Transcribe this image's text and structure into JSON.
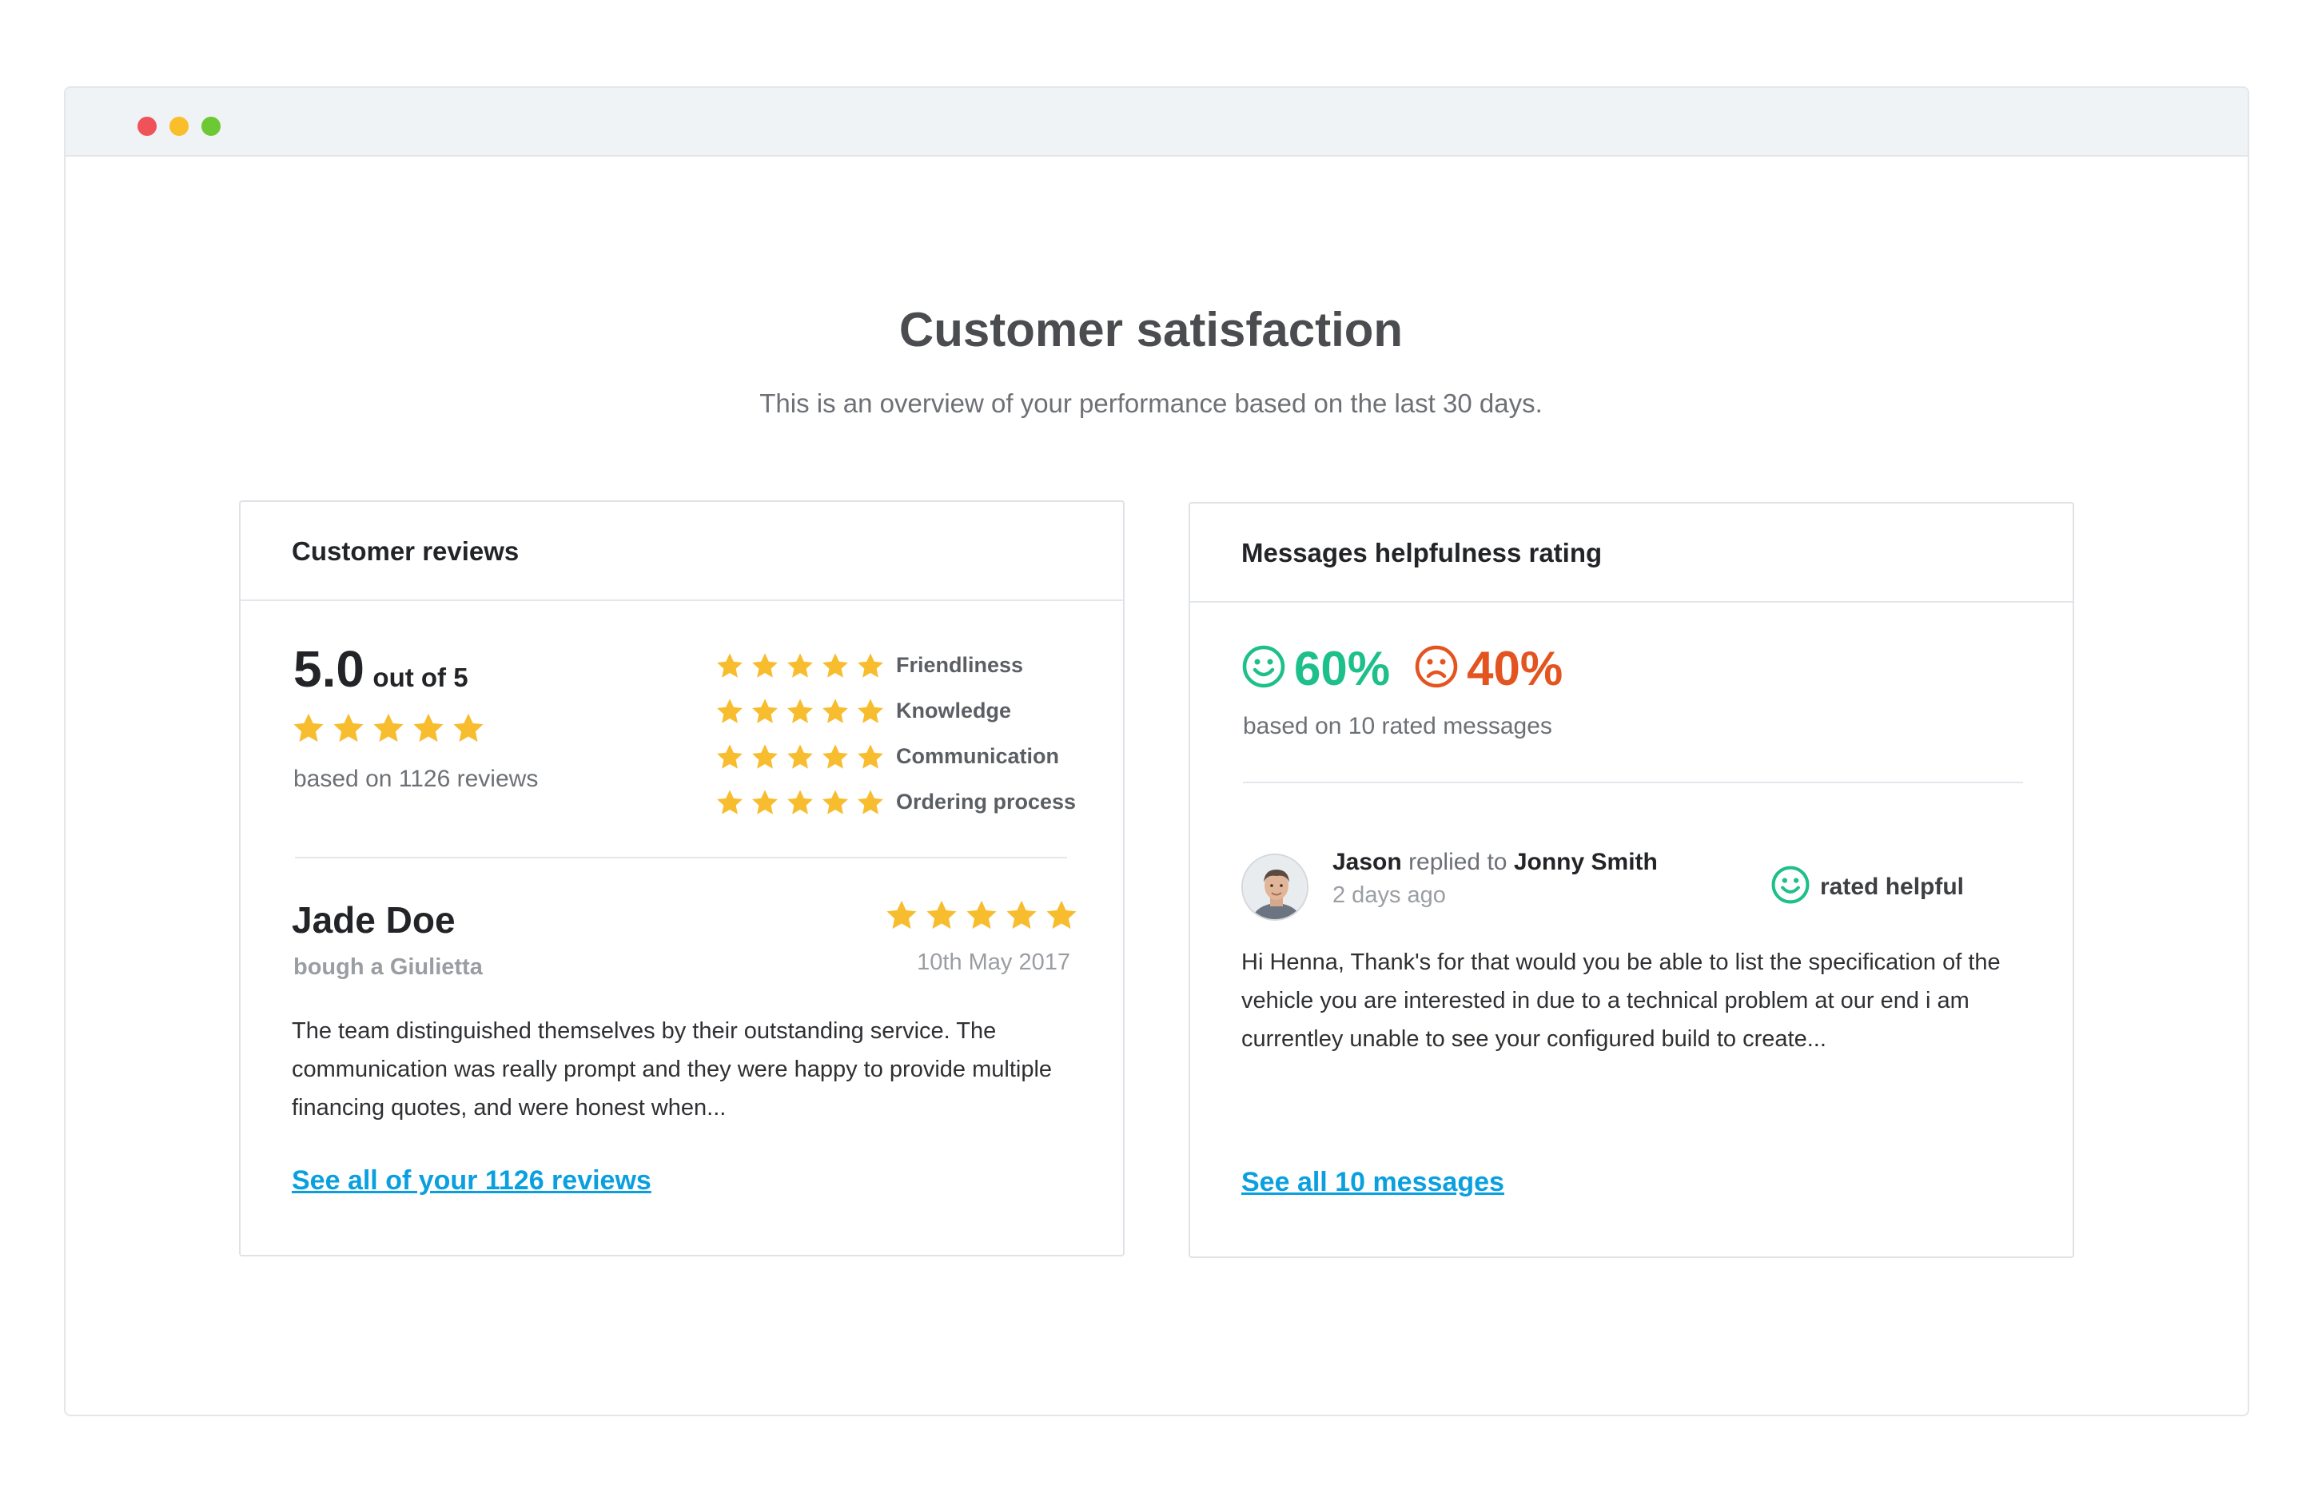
{
  "page": {
    "title": "Customer satisfaction",
    "subtitle": "This is an overview of your performance based on the last 30 days."
  },
  "reviews_card": {
    "header": "Customer reviews",
    "score": "5.0",
    "score_suffix": "out of 5",
    "overall_stars": 5,
    "based_on": "based on 1126 reviews",
    "categories": [
      {
        "label": "Friendliness",
        "stars": 5
      },
      {
        "label": "Knowledge",
        "stars": 5
      },
      {
        "label": "Communication",
        "stars": 5
      },
      {
        "label": "Ordering process",
        "stars": 5
      }
    ],
    "review": {
      "name": "Jade Doe",
      "bought": "bough a Giulietta",
      "stars": 5,
      "date": "10th May 2017",
      "text": "The team distinguished themselves by their outstanding service. The communication was really prompt and they were happy to provide multiple financing quotes, and were honest when..."
    },
    "link": "See all of your 1126 reviews"
  },
  "messages_card": {
    "header": "Messages helpfulness rating",
    "positive_pct": "60%",
    "negative_pct": "40%",
    "based_on": "based on 10 rated messages",
    "message": {
      "sender": "Jason",
      "action": "replied to",
      "recipient": "Jonny Smith",
      "time": "2 days ago",
      "rating": "rated helpful",
      "text": "Hi Henna, Thank's for that would you be able to list the specification of the vehicle you are interested in due to a technical problem at our end i am currentley unable to see your configured build to create..."
    },
    "link": "See all 10 messages"
  },
  "colors": {
    "star": "#f8bd2e",
    "positive": "#1dbf8a",
    "negative": "#e35420",
    "link": "#0aa0e0"
  },
  "icons": [
    "star-icon",
    "smiley-happy-icon",
    "smiley-sad-icon",
    "avatar"
  ]
}
